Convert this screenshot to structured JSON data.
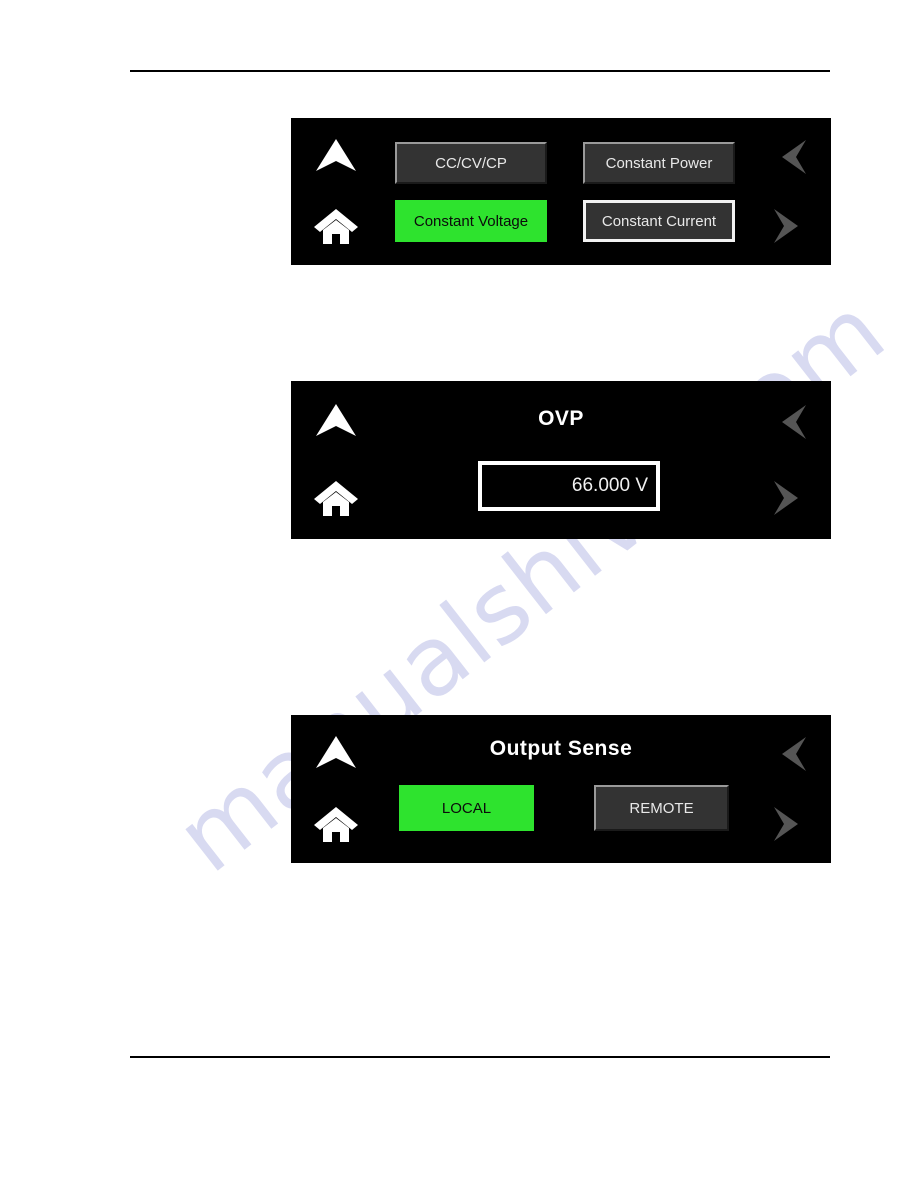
{
  "page": {
    "background": "#ffffff",
    "watermark": "manualshive.com",
    "watermark_color": "#b9bce6"
  },
  "colors": {
    "screen_background": "#000000",
    "active_green": "#2ee32e",
    "button_dark": "#333333",
    "nav_white": "#ffffff",
    "nav_gray": "#555555"
  },
  "nav": {
    "up_icon": "chevron-up-icon",
    "home_icon": "home-icon",
    "left_icon": "chevron-left-icon",
    "right_icon": "chevron-right-icon"
  },
  "screens": [
    {
      "id": "mode-select",
      "title": "",
      "buttons": [
        {
          "label": "CC/CV/CP",
          "state": "normal"
        },
        {
          "label": "Constant Power",
          "state": "normal"
        },
        {
          "label": "Constant Voltage",
          "state": "active"
        },
        {
          "label": "Constant Current",
          "state": "focused"
        }
      ]
    },
    {
      "id": "ovp",
      "title": "OVP",
      "value": "66.000 V"
    },
    {
      "id": "output-sense",
      "title": "Output Sense",
      "buttons": [
        {
          "label": "LOCAL",
          "state": "active"
        },
        {
          "label": "REMOTE",
          "state": "normal"
        }
      ]
    }
  ]
}
